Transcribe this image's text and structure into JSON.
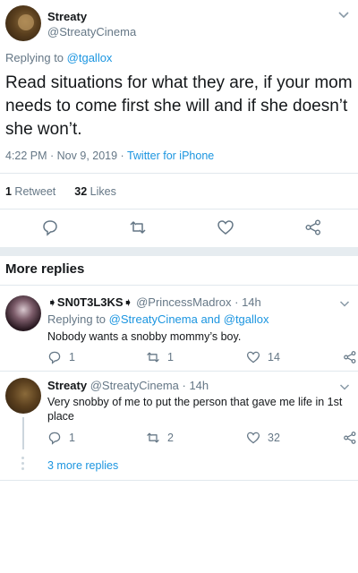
{
  "tweet": {
    "name": "Streaty",
    "handle": "@StreatyCinema",
    "replying_prefix": "Replying to ",
    "replying_to": "@tgallox",
    "text": "Read situations for what they are, if your mom needs to come first she will and if she doesn’t she won’t.",
    "time": "4:22 PM · Nov 9, 2019 · ",
    "source": "Twitter for iPhone",
    "retweet_count": "1",
    "retweet_label": " Retweet",
    "like_count": "32",
    "like_label": " Likes"
  },
  "more_replies_title": "More replies",
  "replies": [
    {
      "name": "➧SN0T3L3KS➧",
      "handle": "@PrincessMadrox",
      "time": " · 14h",
      "replying_prefix": "Replying to ",
      "replying_to": "@StreatyCinema and @tgallox",
      "text": "Nobody wants a snobby mommy’s boy.",
      "reply_count": "1",
      "retweet_count": "1",
      "like_count": "14"
    },
    {
      "name": "Streaty",
      "handle": "@StreatyCinema",
      "time": " · 14h",
      "text": "Very snobby of me to put the person that gave me life in 1st place",
      "reply_count": "1",
      "retweet_count": "2",
      "like_count": "32"
    }
  ],
  "more_replies_link": "3 more replies",
  "colors": {
    "link": "#1b95e0",
    "muted": "#657786",
    "divider": "#e1e8ed",
    "band": "#e6ecf0"
  },
  "icons": [
    "chevron-down-icon",
    "reply-icon",
    "retweet-icon",
    "like-icon",
    "share-icon"
  ]
}
